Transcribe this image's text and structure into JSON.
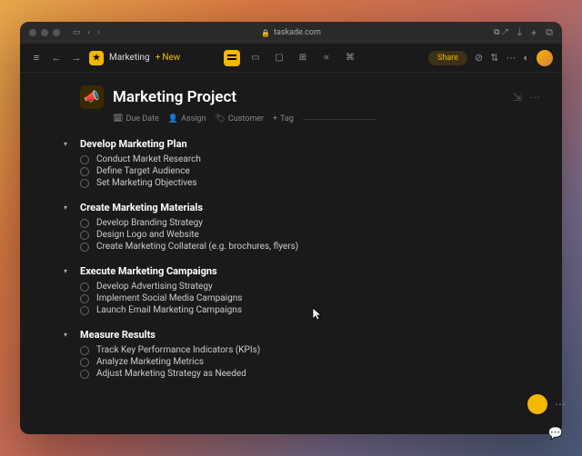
{
  "browser": {
    "url": "taskade.com"
  },
  "toolbar": {
    "workspace": "Marketing",
    "new_label": "New",
    "share_label": "Share"
  },
  "project": {
    "icon": "📣",
    "title": "Marketing Project",
    "meta": {
      "due_date": "Due Date",
      "assign": "Assign",
      "customer": "Customer",
      "tag": "Tag"
    }
  },
  "sections": [
    {
      "title": "Develop Marketing Plan",
      "tasks": [
        "Conduct Market Research",
        "Define Target Audience",
        "Set Marketing Objectives"
      ]
    },
    {
      "title": "Create Marketing Materials",
      "tasks": [
        "Develop Branding Strategy",
        "Design Logo and Website",
        "Create Marketing Collateral (e.g. brochures, flyers)"
      ]
    },
    {
      "title": "Execute Marketing Campaigns",
      "tasks": [
        "Develop Advertising Strategy",
        "Implement Social Media Campaigns",
        "Launch Email Marketing Campaigns"
      ]
    },
    {
      "title": "Measure Results",
      "tasks": [
        "Track Key Performance Indicators (KPIs)",
        "Analyze Marketing Metrics",
        "Adjust Marketing Strategy as Needed"
      ]
    }
  ]
}
